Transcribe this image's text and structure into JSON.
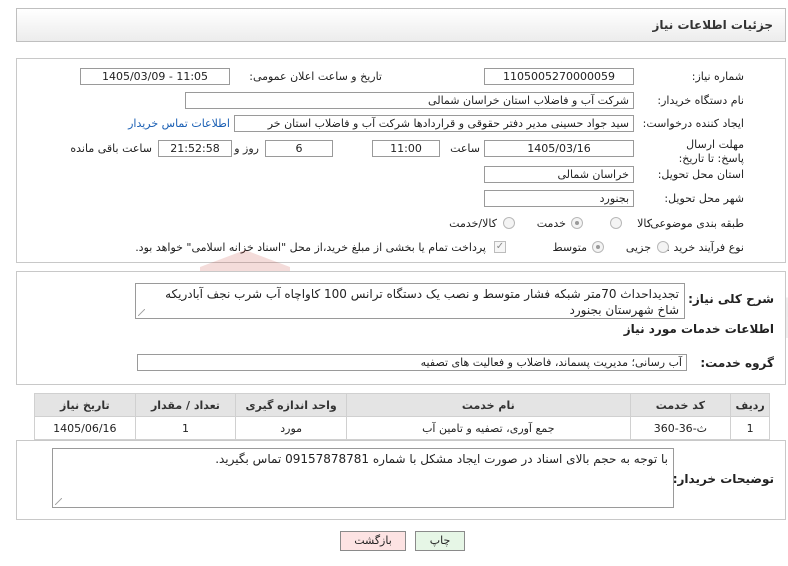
{
  "page": {
    "title": "جزئیات اطلاعات نیاز"
  },
  "fields": {
    "need_number_label": "شماره نیاز:",
    "need_number": "1105005270000059",
    "announce_label": "تاریخ و ساعت اعلان عمومی:",
    "announce_value": "1405/03/09 - 11:05",
    "buyer_org_label": "نام دستگاه خریدار:",
    "buyer_org": "شرکت آب و فاضلاب استان خراسان شمالی",
    "creator_label": "ایجاد کننده درخواست:",
    "creator": "سید جواد حسینی مدیر دفتر حقوقی و قراردادها  شرکت آب و فاضلاب استان خر",
    "contact_link": "اطلاعات تماس خریدار",
    "deadline_label": "مهلت ارسال پاسخ: تا تاریخ:",
    "deadline_date": "1405/03/16",
    "time_label": "ساعت",
    "deadline_time": "11:00",
    "days_value": "6",
    "days_label": "روز و",
    "remaining_time": "21:52:58",
    "remaining_label": "ساعت باقی مانده",
    "province_label": "استان محل تحویل:",
    "province": "خراسان شمالی",
    "city_label": "شهر محل تحویل:",
    "city": "بجنورد",
    "category_label": "طبقه بندی موضوعی:",
    "category_options": [
      "کالا",
      "خدمت",
      "کالا/خدمت"
    ],
    "category_selected": "خدمت",
    "process_label": "نوع فرآیند خرید :",
    "process_options": [
      "جزیی",
      "متوسط"
    ],
    "process_selected": "متوسط",
    "payment_note": "پرداخت تمام یا بخشی از مبلغ خرید،از محل \"اسناد خزانه اسلامی\" خواهد بود."
  },
  "description": {
    "label": "شرح کلی نیاز:",
    "text": "تجدیداحداث 70متر شبکه فشار متوسط و نصب یک دستگاه ترانس 100 کاواچاه آب شرب نجف آبادریکه شاخ شهرستان بجنورد"
  },
  "services": {
    "section_title": "اطلاعات خدمات مورد نیاز",
    "group_label": "گروه خدمت:",
    "group_value": "آب رسانی؛ مدیریت پسماند، فاضلاب و فعالیت های تصفیه",
    "table": {
      "headers": [
        "ردیف",
        "کد خدمت",
        "نام خدمت",
        "واحد اندازه گیری",
        "تعداد / مقدار",
        "تاریخ نیاز"
      ],
      "rows": [
        [
          "1",
          "ث-36-360",
          "جمع آوری، تصفیه و تامین آب",
          "مورد",
          "1",
          "1405/06/16"
        ]
      ]
    }
  },
  "buyer_notes": {
    "label": "توضیحات خریدار:",
    "text": "با توجه به حجم بالای اسناد در صورت ایجاد مشکل با شماره 09157878781 تماس بگیرید."
  },
  "buttons": {
    "print": "چاپ",
    "back": "بازگشت"
  },
  "watermark": {
    "text": "AriaTender.neT"
  },
  "colors": {
    "link": "#1a5fb4",
    "back_button_bg": "#fde3e3",
    "print_button_bg": "#e6f6e6",
    "watermark_red": "#c0392b"
  }
}
